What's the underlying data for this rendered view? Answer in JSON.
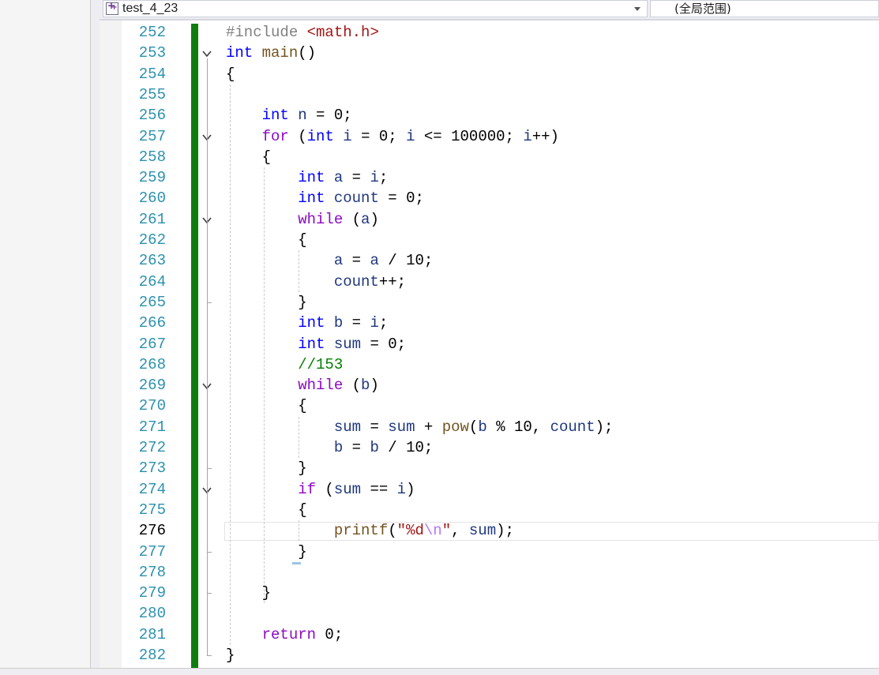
{
  "navbar": {
    "project": "test_4_23",
    "scope": "(全局范围)"
  },
  "editor": {
    "current_line": 276,
    "lines": [
      {
        "n": "252",
        "tokens": [
          [
            "preproc",
            "#include "
          ],
          [
            "header",
            "<math.h>"
          ]
        ]
      },
      {
        "n": "253",
        "tokens": [
          [
            "keyword",
            "int"
          ],
          [
            "plain",
            " "
          ],
          [
            "func",
            "main"
          ],
          [
            "plain",
            "()"
          ]
        ]
      },
      {
        "n": "254",
        "tokens": [
          [
            "plain",
            "{"
          ]
        ]
      },
      {
        "n": "255",
        "tokens": []
      },
      {
        "n": "256",
        "tokens": [
          [
            "plain",
            "    "
          ],
          [
            "keyword",
            "int"
          ],
          [
            "plain",
            " "
          ],
          [
            "ident",
            "n"
          ],
          [
            "plain",
            " = 0;"
          ]
        ]
      },
      {
        "n": "257",
        "tokens": [
          [
            "plain",
            "    "
          ],
          [
            "control",
            "for"
          ],
          [
            "plain",
            " ("
          ],
          [
            "keyword",
            "int"
          ],
          [
            "plain",
            " "
          ],
          [
            "ident",
            "i"
          ],
          [
            "plain",
            " = 0; "
          ],
          [
            "ident",
            "i"
          ],
          [
            "plain",
            " <= 100000; "
          ],
          [
            "ident",
            "i"
          ],
          [
            "plain",
            "++)"
          ]
        ]
      },
      {
        "n": "258",
        "tokens": [
          [
            "plain",
            "    {"
          ]
        ]
      },
      {
        "n": "259",
        "tokens": [
          [
            "plain",
            "        "
          ],
          [
            "keyword",
            "int"
          ],
          [
            "plain",
            " "
          ],
          [
            "ident",
            "a"
          ],
          [
            "plain",
            " = "
          ],
          [
            "ident",
            "i"
          ],
          [
            "plain",
            ";"
          ]
        ]
      },
      {
        "n": "260",
        "tokens": [
          [
            "plain",
            "        "
          ],
          [
            "keyword",
            "int"
          ],
          [
            "plain",
            " "
          ],
          [
            "ident",
            "count"
          ],
          [
            "plain",
            " = 0;"
          ]
        ]
      },
      {
        "n": "261",
        "tokens": [
          [
            "plain",
            "        "
          ],
          [
            "control",
            "while"
          ],
          [
            "plain",
            " ("
          ],
          [
            "ident",
            "a"
          ],
          [
            "plain",
            ")"
          ]
        ]
      },
      {
        "n": "262",
        "tokens": [
          [
            "plain",
            "        {"
          ]
        ]
      },
      {
        "n": "263",
        "tokens": [
          [
            "plain",
            "            "
          ],
          [
            "ident",
            "a"
          ],
          [
            "plain",
            " = "
          ],
          [
            "ident",
            "a"
          ],
          [
            "plain",
            " / 10;"
          ]
        ]
      },
      {
        "n": "264",
        "tokens": [
          [
            "plain",
            "            "
          ],
          [
            "ident",
            "count"
          ],
          [
            "plain",
            "++;"
          ]
        ]
      },
      {
        "n": "265",
        "tokens": [
          [
            "plain",
            "        }"
          ]
        ]
      },
      {
        "n": "266",
        "tokens": [
          [
            "plain",
            "        "
          ],
          [
            "keyword",
            "int"
          ],
          [
            "plain",
            " "
          ],
          [
            "ident",
            "b"
          ],
          [
            "plain",
            " = "
          ],
          [
            "ident",
            "i"
          ],
          [
            "plain",
            ";"
          ]
        ]
      },
      {
        "n": "267",
        "tokens": [
          [
            "plain",
            "        "
          ],
          [
            "keyword",
            "int"
          ],
          [
            "plain",
            " "
          ],
          [
            "ident",
            "sum"
          ],
          [
            "plain",
            " = 0;"
          ]
        ]
      },
      {
        "n": "268",
        "tokens": [
          [
            "plain",
            "        "
          ],
          [
            "comment",
            "//153"
          ]
        ]
      },
      {
        "n": "269",
        "tokens": [
          [
            "plain",
            "        "
          ],
          [
            "control",
            "while"
          ],
          [
            "plain",
            " ("
          ],
          [
            "ident",
            "b"
          ],
          [
            "plain",
            ")"
          ]
        ]
      },
      {
        "n": "270",
        "tokens": [
          [
            "plain",
            "        {"
          ]
        ]
      },
      {
        "n": "271",
        "tokens": [
          [
            "plain",
            "            "
          ],
          [
            "ident",
            "sum"
          ],
          [
            "plain",
            " = "
          ],
          [
            "ident",
            "sum"
          ],
          [
            "plain",
            " + "
          ],
          [
            "func",
            "pow"
          ],
          [
            "plain",
            "("
          ],
          [
            "ident",
            "b"
          ],
          [
            "plain",
            " % 10, "
          ],
          [
            "ident",
            "count"
          ],
          [
            "plain",
            ");"
          ]
        ]
      },
      {
        "n": "272",
        "tokens": [
          [
            "plain",
            "            "
          ],
          [
            "ident",
            "b"
          ],
          [
            "plain",
            " = "
          ],
          [
            "ident",
            "b"
          ],
          [
            "plain",
            " / 10;"
          ]
        ]
      },
      {
        "n": "273",
        "tokens": [
          [
            "plain",
            "        }"
          ]
        ]
      },
      {
        "n": "274",
        "tokens": [
          [
            "plain",
            "        "
          ],
          [
            "control",
            "if"
          ],
          [
            "plain",
            " ("
          ],
          [
            "ident",
            "sum"
          ],
          [
            "plain",
            " == "
          ],
          [
            "ident",
            "i"
          ],
          [
            "plain",
            ")"
          ]
        ]
      },
      {
        "n": "275",
        "tokens": [
          [
            "plain",
            "        {"
          ]
        ]
      },
      {
        "n": "276",
        "tokens": [
          [
            "plain",
            "            "
          ],
          [
            "func",
            "printf"
          ],
          [
            "plain",
            "("
          ],
          [
            "string",
            "\"%d"
          ],
          [
            "escape",
            "\\n"
          ],
          [
            "string",
            "\""
          ],
          [
            "plain",
            ", "
          ],
          [
            "ident",
            "sum"
          ],
          [
            "plain",
            ");"
          ]
        ]
      },
      {
        "n": "277",
        "tokens": [
          [
            "plain",
            "        }"
          ]
        ]
      },
      {
        "n": "278",
        "tokens": []
      },
      {
        "n": "279",
        "tokens": [
          [
            "plain",
            "    }"
          ]
        ]
      },
      {
        "n": "280",
        "tokens": []
      },
      {
        "n": "281",
        "tokens": [
          [
            "plain",
            "    "
          ],
          [
            "control",
            "return"
          ],
          [
            "plain",
            " 0;"
          ]
        ]
      },
      {
        "n": "282",
        "tokens": [
          [
            "plain",
            "}"
          ]
        ]
      }
    ],
    "fold_icon": "chevron-down-icon",
    "change_indicator_color": "#107c10"
  }
}
